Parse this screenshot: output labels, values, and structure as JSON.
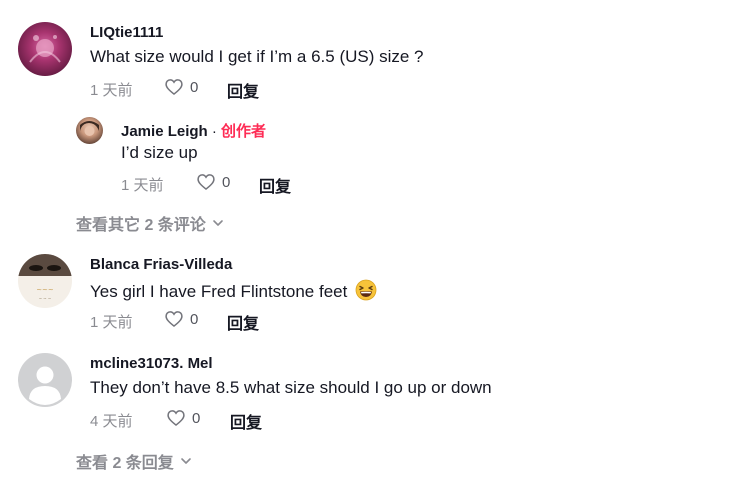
{
  "comments": [
    {
      "username": "LIQtie1111",
      "text": "What size would I get if I’m a 6.5 (US) size ?",
      "time": "1 天前",
      "likes": "0",
      "reply_label": "回复"
    },
    {
      "username": "Jamie Leigh",
      "separator": " · ",
      "creator_label": "创作者",
      "text": "I’d size up",
      "time": "1 天前",
      "likes": "0",
      "reply_label": "回复"
    },
    {
      "username": "Blanca Frias-Villeda",
      "text": "Yes girl I have Fred Flintstone feet",
      "emoji": "grinning-squinting-face-emoji",
      "time": "1 天前",
      "likes": "0",
      "reply_label": "回复"
    },
    {
      "username": "mcline31073. Mel",
      "text": "They don’t have 8.5 what size should I go up or down",
      "time": "4 天前",
      "likes": "0",
      "reply_label": "回复"
    }
  ],
  "view_more_1": "查看其它 2 条评论",
  "view_more_2": "查看 2 条回复",
  "colors": {
    "primary_text": "#161823",
    "secondary_text": "rgba(22,24,35,0.5)",
    "creator_accent": "#fe2c55",
    "background": "#ffffff"
  },
  "icons": [
    "heart-outline-icon",
    "chevron-down-icon",
    "default-avatar-icon"
  ]
}
